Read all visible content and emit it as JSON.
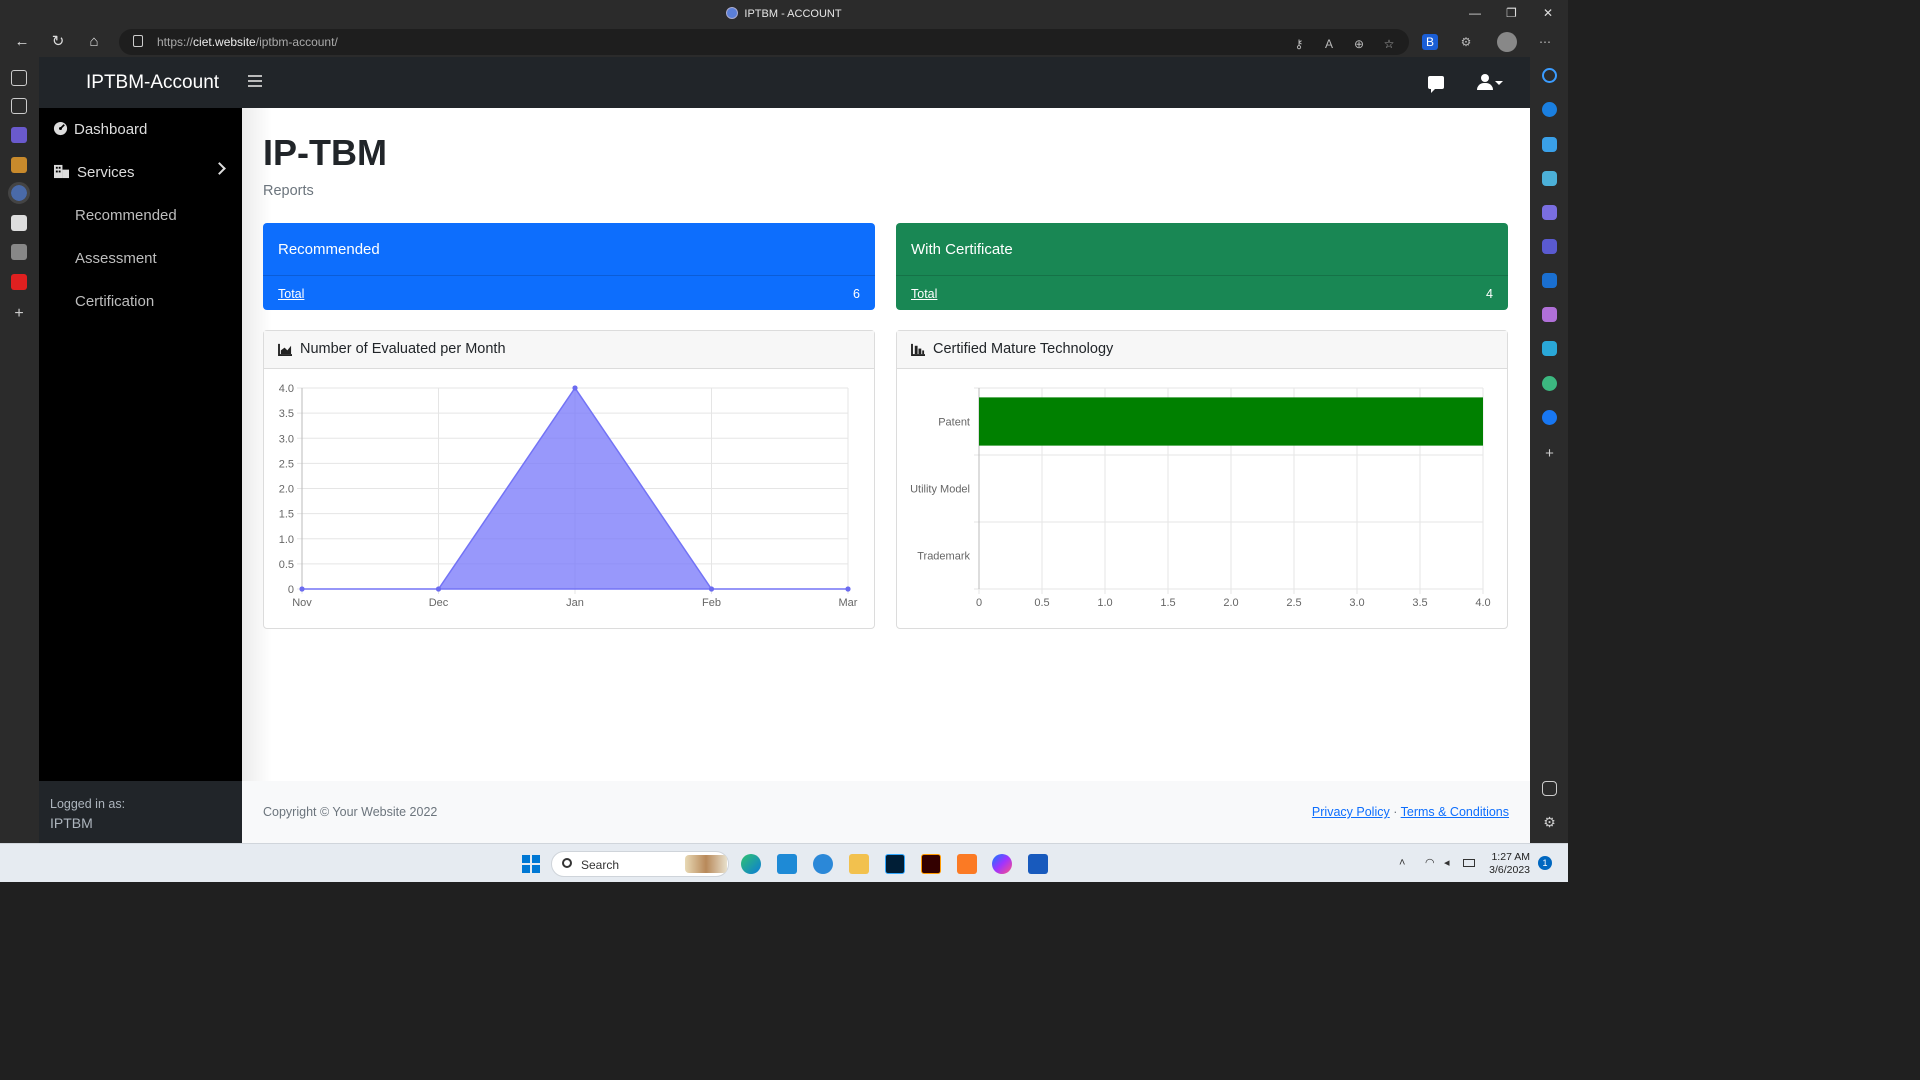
{
  "browser": {
    "tab_title": "IPTBM - ACCOUNT",
    "url_prefix": "https://",
    "url_host": "ciet.website",
    "url_path": "/iptbm-account/"
  },
  "app": {
    "brand": "IPTBM-Account"
  },
  "sidebar": {
    "items": [
      {
        "label": "Dashboard",
        "icon": "dashboard-icon"
      },
      {
        "label": "Services",
        "icon": "services-icon"
      },
      {
        "label": "Recommended"
      },
      {
        "label": "Assessment"
      },
      {
        "label": "Certification"
      }
    ],
    "footer_label": "Logged in as:",
    "footer_user": "IPTBM"
  },
  "page": {
    "title": "IP-TBM",
    "breadcrumb": "Reports"
  },
  "cards": [
    {
      "title": "Recommended",
      "footer_label": "Total",
      "value": "6",
      "color": "#0d6efd"
    },
    {
      "title": "With Certificate",
      "footer_label": "Total",
      "value": "4",
      "color": "#198754"
    }
  ],
  "panels": {
    "left_title": "Number of Evaluated per Month",
    "right_title": "Certified Mature Technology"
  },
  "chart_data": [
    {
      "type": "area",
      "title": "Number of Evaluated per Month",
      "categories": [
        "Nov",
        "Dec",
        "Jan",
        "Feb",
        "Mar"
      ],
      "values": [
        0,
        0,
        4,
        0,
        0
      ],
      "ylim": [
        0,
        4
      ],
      "yticks": [
        "0",
        "0.5",
        "1.0",
        "1.5",
        "2.0",
        "2.5",
        "3.0",
        "3.5",
        "4.0"
      ],
      "color": "#7b7bfa",
      "grid": true
    },
    {
      "type": "bar",
      "orientation": "horizontal",
      "title": "Certified Mature Technology",
      "categories": [
        "Patent",
        "Utility Model",
        "Trademark"
      ],
      "values": [
        4,
        0,
        0
      ],
      "xlim": [
        0,
        4
      ],
      "xticks": [
        "0",
        "0.5",
        "1.0",
        "1.5",
        "2.0",
        "2.5",
        "3.0",
        "3.5",
        "4.0"
      ],
      "color": "#008000",
      "grid": true
    }
  ],
  "footer": {
    "copyright": "Copyright © Your Website 2022",
    "privacy": "Privacy Policy",
    "separator": "·",
    "terms": "Terms & Conditions"
  },
  "taskbar": {
    "search_label": "Search",
    "time": "1:27 AM",
    "date": "3/6/2023",
    "notification_count": "1"
  }
}
